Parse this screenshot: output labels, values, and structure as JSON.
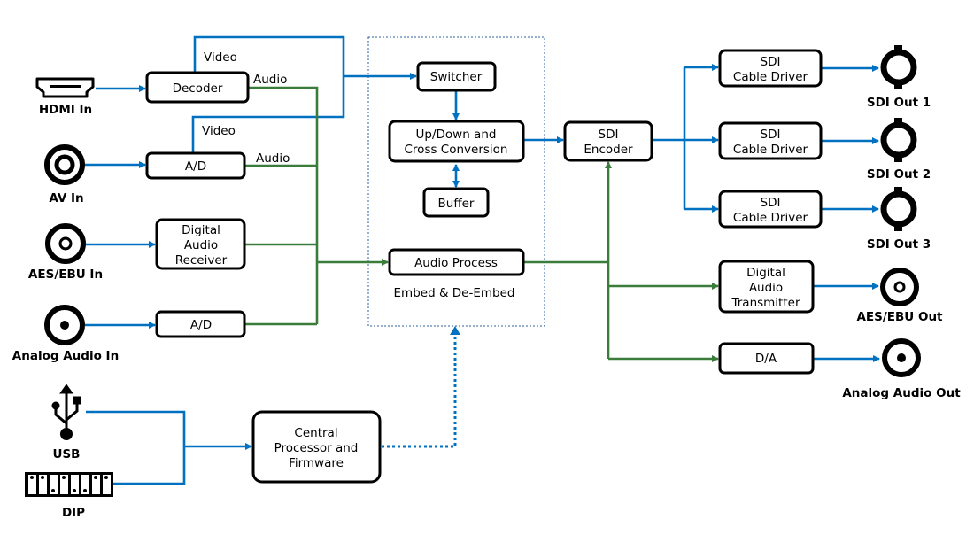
{
  "colors": {
    "video_line": "#0070C0",
    "audio_line": "#3A7D3A",
    "box_border": "#000000"
  },
  "inputs": {
    "hdmi": "HDMI In",
    "av": "AV In",
    "aes": "AES/EBU In",
    "analog": "Analog Audio In",
    "usb": "USB",
    "dip": "DIP"
  },
  "outputs": {
    "sdi1": "SDI Out 1",
    "sdi2": "SDI Out 2",
    "sdi3": "SDI Out 3",
    "aes": "AES/EBU Out",
    "analog": "Analog Audio Out"
  },
  "signals": {
    "video1": "Video",
    "audio1": "Audio",
    "video2": "Video",
    "audio2": "Audio"
  },
  "blocks": {
    "decoder": "Decoder",
    "ad_video": "A/D",
    "dar": [
      "Digital",
      "Audio",
      "Receiver"
    ],
    "ad_audio": "A/D",
    "switcher": "Switcher",
    "updown": [
      "Up/Down and",
      "Cross Conversion"
    ],
    "buffer": "Buffer",
    "audio_process": "Audio Process",
    "embed_caption": "Embed & De-Embed",
    "sdi_encoder": [
      "SDI",
      "Encoder"
    ],
    "cable_driver": [
      "SDI",
      "Cable Driver"
    ],
    "dat": [
      "Digital",
      "Audio",
      "Transmitter"
    ],
    "da": "D/A",
    "cpu": [
      "Central",
      "Processor and",
      "Firmware"
    ]
  }
}
